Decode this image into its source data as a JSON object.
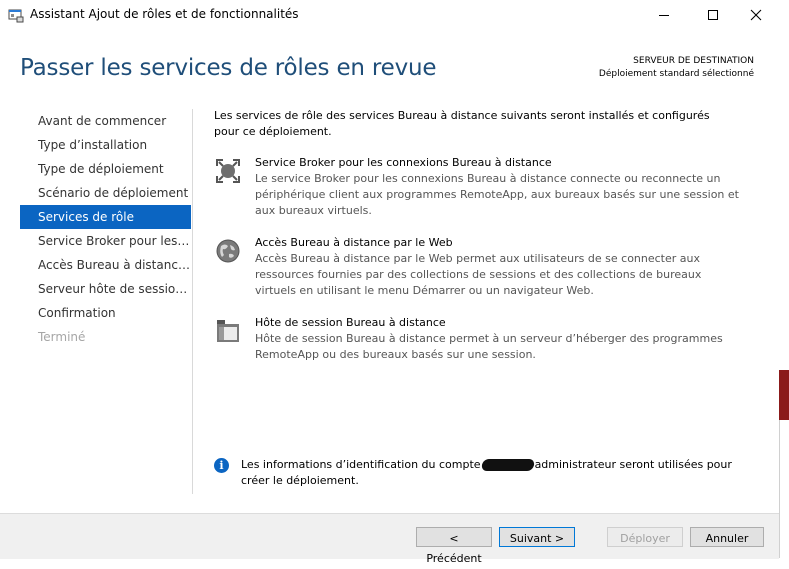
{
  "window": {
    "title": "Assistant Ajout de rôles et de fonctionnalités"
  },
  "page": {
    "heading": "Passer les services de rôles en revue",
    "destination_label": "SERVEUR DE DESTINATION",
    "destination_value": "Déploiement standard sélectionné"
  },
  "sidebar": {
    "items": [
      {
        "label": "Avant de commencer",
        "state": "normal"
      },
      {
        "label": "Type d’installation",
        "state": "normal"
      },
      {
        "label": "Type de déploiement",
        "state": "normal"
      },
      {
        "label": "Scénario de déploiement",
        "state": "normal"
      },
      {
        "label": "Services de rôle",
        "state": "active"
      },
      {
        "label": "Service Broker pour les connexions Bureau à distance",
        "state": "normal"
      },
      {
        "label": "Accès Bureau à distance par le Web",
        "state": "normal"
      },
      {
        "label": "Serveur hôte de session Bureau à distance",
        "state": "normal"
      },
      {
        "label": "Confirmation",
        "state": "normal"
      },
      {
        "label": "Terminé",
        "state": "disabled"
      }
    ]
  },
  "content": {
    "intro": "Les services de rôle des services Bureau à distance suivants seront installés et configurés pour ce déploiement.",
    "services": [
      {
        "icon": "connection-broker-icon",
        "title": "Service Broker pour les connexions Bureau à distance",
        "description": "Le service Broker pour les connexions Bureau à distance connecte ou reconnecte un périphérique client aux programmes RemoteApp, aux bureaux basés sur une session et aux bureaux virtuels."
      },
      {
        "icon": "web-access-globe-icon",
        "title": "Accès Bureau à distance par le Web",
        "description": "Accès Bureau à distance par le Web permet aux utilisateurs de se connecter aux ressources fournies par des collections de sessions et des collections de bureaux virtuels en utilisant le menu Démarrer ou un navigateur Web."
      },
      {
        "icon": "session-host-icon",
        "title": "Hôte de session Bureau à distance",
        "description": "Hôte de session Bureau à distance permet à un serveur d’héberger des programmes RemoteApp ou des bureaux basés sur une session."
      }
    ],
    "info_before": "Les informations d’identification du compte",
    "info_after": "administrateur seront utilisées pour créer le déploiement."
  },
  "footer": {
    "previous": "< Précédent",
    "next": "Suivant >",
    "deploy": "Déployer",
    "cancel": "Annuler"
  },
  "colors": {
    "heading": "#1f4e79",
    "active_nav": "#0b65c2",
    "info_icon": "#0b65c2"
  }
}
